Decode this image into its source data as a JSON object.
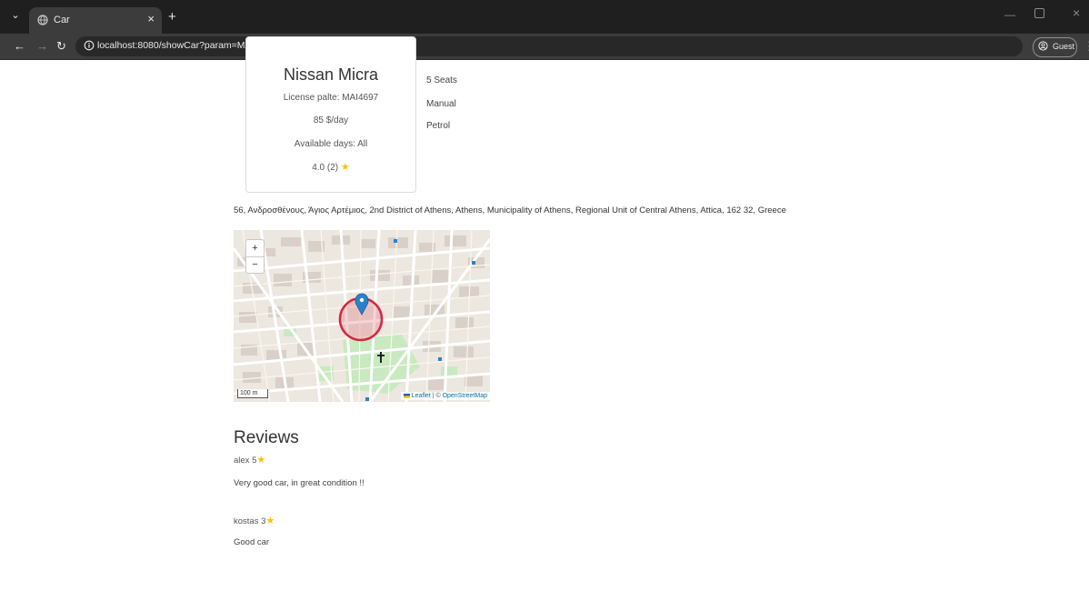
{
  "browser": {
    "tab_title": "Car",
    "url": "localhost:8080/showCar?param=MAI4697",
    "profile_label": "Guest"
  },
  "car": {
    "name": "Nissan Micra",
    "license": "License palte: MAI4697",
    "price": "85 $/day",
    "availability": "Available days: All",
    "rating_text": "4.0 (2)",
    "specs": {
      "seats": "5 Seats",
      "transmission": "Manual",
      "fuel": "Petrol"
    }
  },
  "location": {
    "address": "56, Ανδροσθένους, Άγιος Αρτέμιος, 2nd District of Athens, Athens, Municipality of Athens, Regional Unit of Central Athens, Attica, 162 32, Greece",
    "map": {
      "zoom_in": "+",
      "zoom_out": "−",
      "scale_label": "100 m",
      "attribution_leaflet": "Leaflet",
      "attribution_sep": "| ©",
      "attribution_osm": "OpenStreetMap",
      "marker_color": "#2a81cb",
      "circle_color": "#d7263d"
    }
  },
  "reviews": {
    "title": "Reviews",
    "items": [
      {
        "author_rating": "alex 5",
        "text": "Very good car, in great condition !!"
      },
      {
        "author_rating": "kostas 3",
        "text": "Good car"
      }
    ]
  },
  "colors": {
    "star": "#f6c30b",
    "tab_bar": "#1f1f1f",
    "toolbar": "#3c3c3c"
  }
}
